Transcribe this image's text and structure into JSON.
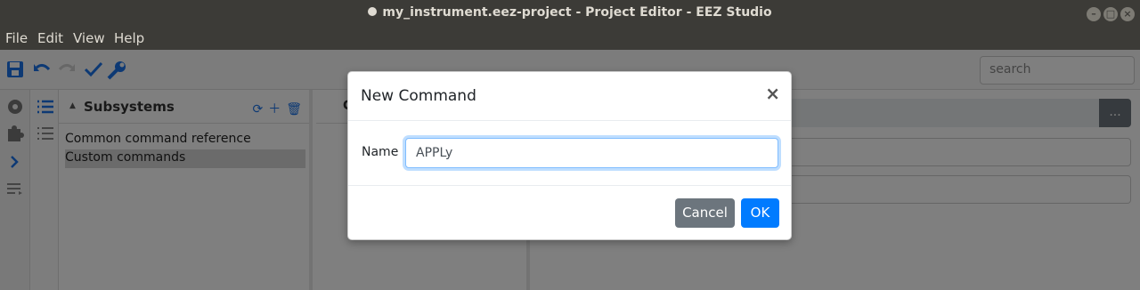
{
  "window": {
    "title": "my_instrument.eez-project - Project Editor - EEZ Studio"
  },
  "menu": [
    "File",
    "Edit",
    "View",
    "Help"
  ],
  "toolbar": {
    "search_placeholder": "search"
  },
  "subsystems": {
    "title": "Subsystems",
    "items": [
      {
        "label": "Common command reference",
        "selected": false
      },
      {
        "label": "Custom commands",
        "selected": true
      }
    ]
  },
  "col2": {
    "title_partial": "C"
  },
  "col3": {
    "more_label": "..."
  },
  "dialog": {
    "title": "New Command",
    "close_glyph": "×",
    "name_label": "Name",
    "name_value": "APPLy",
    "cancel_label": "Cancel",
    "ok_label": "OK"
  },
  "colors": {
    "accent": "#007bff",
    "secondary": "#6c757d",
    "titlebar": "#3c3b37"
  }
}
